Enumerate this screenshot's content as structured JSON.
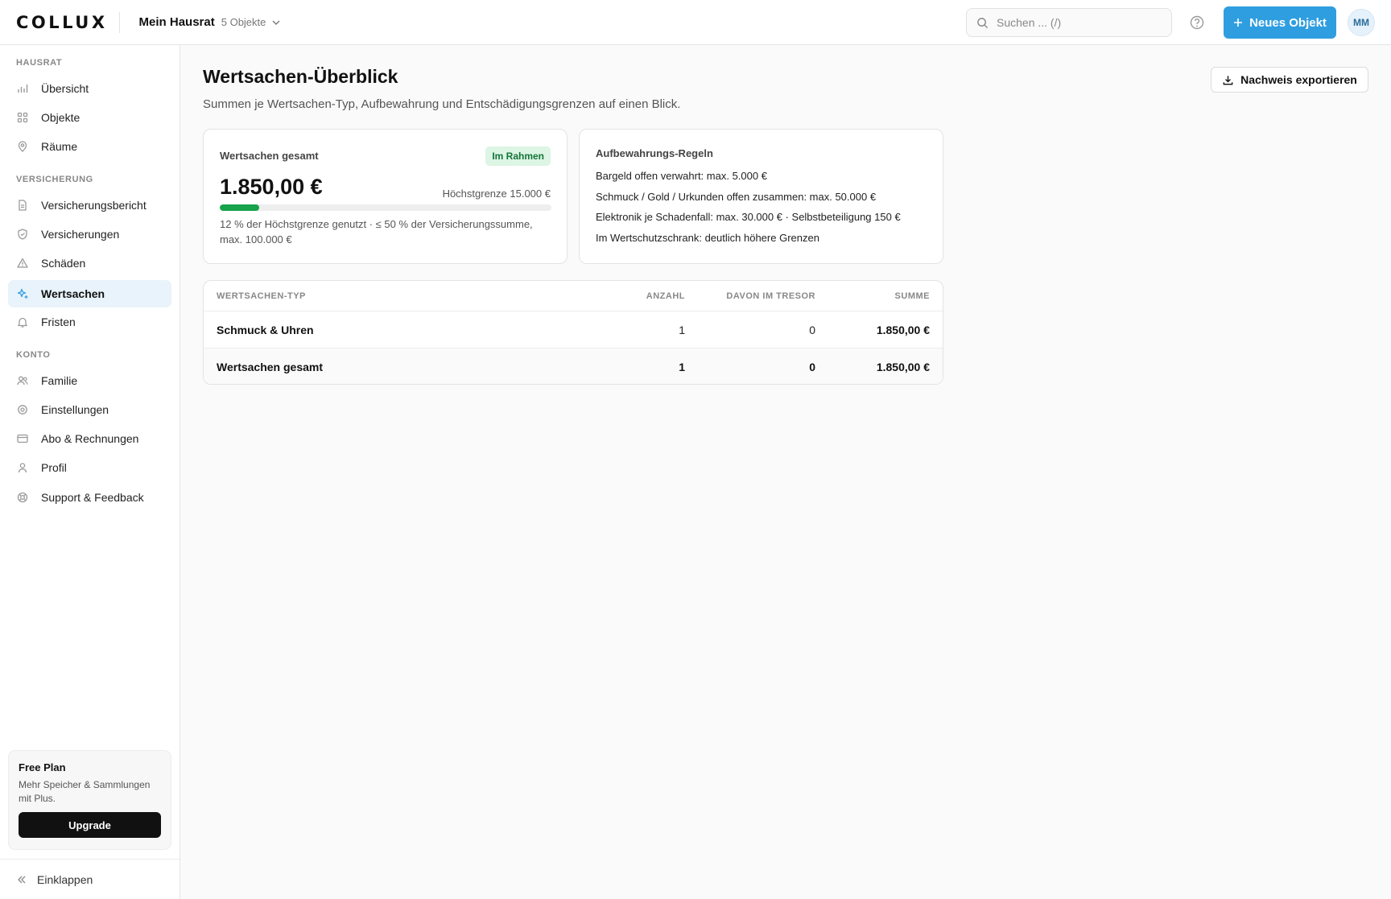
{
  "brand": {
    "logo_text": "COLLUX"
  },
  "header": {
    "household_name": "Mein Hausrat",
    "household_count": "5 Objekte",
    "search_placeholder": "Suchen ... (/)",
    "new_object_label": "Neues Objekt",
    "avatar_initials": "MM",
    "accent_color": "#2f9ee0"
  },
  "sidebar": {
    "sections": [
      {
        "label": "HAUSRAT",
        "items": [
          {
            "label": "Übersicht",
            "icon": "bar-chart-icon"
          },
          {
            "label": "Objekte",
            "icon": "grid-icon"
          },
          {
            "label": "Räume",
            "icon": "map-pin-icon"
          }
        ]
      },
      {
        "label": "VERSICHERUNG",
        "items": [
          {
            "label": "Versicherungsbericht",
            "icon": "document-icon"
          },
          {
            "label": "Versicherungen",
            "icon": "shield-icon"
          },
          {
            "label": "Schäden",
            "icon": "warning-icon"
          },
          {
            "label": "Wertsachen",
            "icon": "sparkle-icon",
            "active": true
          },
          {
            "label": "Fristen",
            "icon": "bell-icon"
          }
        ]
      },
      {
        "label": "KONTO",
        "items": [
          {
            "label": "Familie",
            "icon": "users-icon"
          },
          {
            "label": "Einstellungen",
            "icon": "gear-icon"
          },
          {
            "label": "Abo & Rechnungen",
            "icon": "credit-card-icon"
          },
          {
            "label": "Profil",
            "icon": "user-icon"
          },
          {
            "label": "Support & Feedback",
            "icon": "lifebuoy-icon"
          }
        ]
      }
    ],
    "plan": {
      "title": "Free Plan",
      "description": "Mehr Speicher & Sammlungen mit Plus.",
      "upgrade_label": "Upgrade"
    },
    "collapse_label": "Einklappen"
  },
  "main": {
    "title": "Wertsachen-Überblick",
    "subtitle": "Summen je Wertsachen-Typ, Aufbewahrung und Entschädigungsgrenzen auf einen Blick.",
    "export_label": "Nachweis exportieren",
    "summary": {
      "label": "Wertsachen gesamt",
      "badge": "Im Rahmen",
      "badge_color": "#16733a",
      "total": "1.850,00 €",
      "limit": "Höchstgrenze 15.000 €",
      "usage_fraction": 0.12,
      "note": "12 % der Höchstgrenze genutzt · ≤ 50 % der Versicherungssumme, max. 100.000 €"
    },
    "rules": {
      "title": "Aufbewahrungs-Regeln",
      "items": [
        "Bargeld offen verwahrt: max. 5.000 €",
        "Schmuck / Gold / Urkunden offen zusammen: max. 50.000 €",
        "Elektronik je Schadenfall: max. 30.000 € · Selbstbeteiligung 150 €",
        "Im Wertschutzschrank: deutlich höhere Grenzen"
      ]
    },
    "table": {
      "columns": [
        "WERTSACHEN-TYP",
        "ANZAHL",
        "DAVON IM TRESOR",
        "SUMME"
      ],
      "rows": [
        {
          "type": "Schmuck & Uhren",
          "count": "1",
          "vault": "0",
          "sum": "1.850,00 €"
        }
      ],
      "total_row": {
        "type": "Wertsachen gesamt",
        "count": "1",
        "vault": "0",
        "sum": "1.850,00 €"
      }
    }
  }
}
